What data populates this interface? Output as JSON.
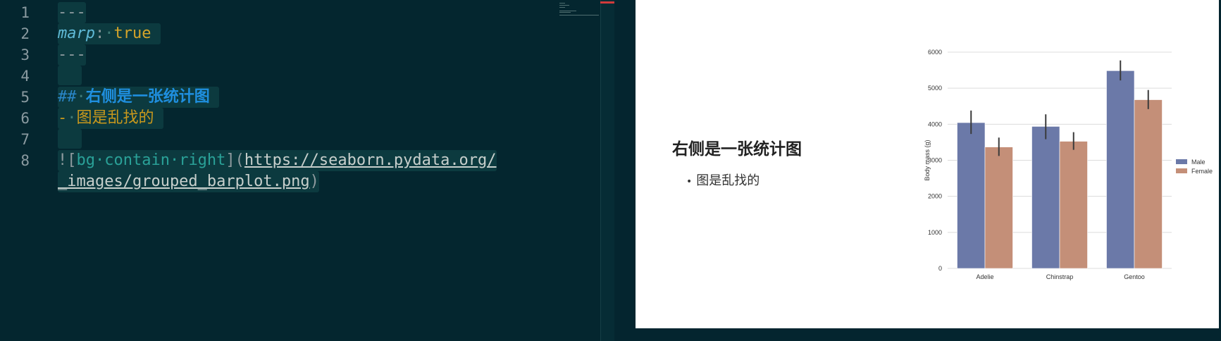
{
  "editor": {
    "line_numbers": [
      "1",
      "2",
      "3",
      "4",
      "5",
      "6",
      "7",
      "8"
    ],
    "line1": {
      "dashes": "---"
    },
    "line2": {
      "key": "marp",
      "colon": ":",
      "ws": "·",
      "value": "true"
    },
    "line3": {
      "dashes": "---"
    },
    "line5": {
      "hashes": "##",
      "ws": "·",
      "heading": "右侧是一张统计图"
    },
    "line6": {
      "bullet": "-",
      "ws": "·",
      "text": "图是乱找的"
    },
    "line8": {
      "open": "![",
      "alt": "bg·contain·right",
      "mid": "](",
      "url_part1": "https://seaborn.pydata.org/",
      "url_part2": "_images/grouped_barplot.png",
      "close": ")"
    }
  },
  "preview": {
    "heading": "右侧是一张统计图",
    "bullets": [
      "图是乱找的"
    ]
  },
  "chart_data": {
    "type": "bar",
    "categories": [
      "Adelie",
      "Chinstrap",
      "Gentoo"
    ],
    "series": [
      {
        "name": "Male",
        "values": [
          4045,
          3939,
          5485
        ],
        "err_low": [
          3730,
          3585,
          5215
        ],
        "err_high": [
          4380,
          4275,
          5770
        ],
        "color": "#6b79a8"
      },
      {
        "name": "Female",
        "values": [
          3369,
          3527,
          4680
        ],
        "err_low": [
          3120,
          3290,
          4420
        ],
        "err_high": [
          3630,
          3780,
          4950
        ],
        "color": "#c48f78"
      }
    ],
    "ylabel": "Body mass (g)",
    "xlabel": "",
    "ylim": [
      0,
      6000
    ],
    "yticks": [
      0,
      1000,
      2000,
      3000,
      4000,
      5000,
      6000
    ],
    "grid": true,
    "legend_position": "right"
  },
  "colors": {
    "editor_bg": "#04262f",
    "accent_red": "#d13b3b"
  }
}
